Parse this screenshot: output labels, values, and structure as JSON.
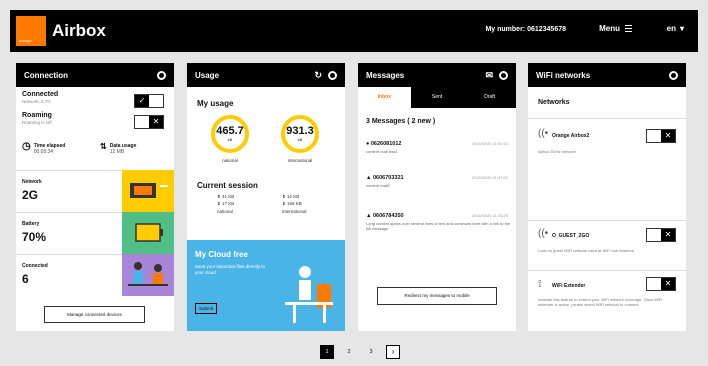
{
  "brand": {
    "logo_text": "orange",
    "title": "Airbox",
    "accent": "#ff7900"
  },
  "header": {
    "my_number": "My number: 0612345678",
    "menu_label": "Menu",
    "lang_label": "en"
  },
  "connection": {
    "title": "Connection",
    "connected_label": "Connected",
    "connected_sub": "Network: 3.7G",
    "roaming_label": "Roaming",
    "roaming_sub": "Roaming is Off",
    "time_label": "Time elapsed",
    "time_value": "00:05:34",
    "data_label": "Data usage",
    "data_value": "12 MB",
    "tiles": [
      {
        "label": "Network",
        "value": "2G"
      },
      {
        "label": "Battery",
        "value": "70%"
      },
      {
        "label": "Connected",
        "value": "6"
      }
    ],
    "manage_button": "Manage connected devices"
  },
  "usage": {
    "title": "Usage",
    "my_usage": "My usage",
    "national_value": "465.7",
    "national_unit": "kB",
    "national_label": "national",
    "intl_value": "931.3",
    "intl_unit": "kB",
    "intl_label": "international",
    "session_title": "Current session",
    "session_nat_up": "41 KB",
    "session_nat_down": "17 KB",
    "session_nat_label": "national",
    "session_int_up": "12 KB",
    "session_int_down": "156 KB",
    "session_int_label": "international",
    "cloud_title": "My Cloud free",
    "cloud_desc": "Save your important files directly to your cloud",
    "cloud_button": "Submit"
  },
  "messages": {
    "title": "Messages",
    "tabs": [
      "Inbox",
      "Sent",
      "Draft"
    ],
    "count": "3 Messages ( 2 new )",
    "items": [
      {
        "number": "0626081012",
        "time": "2015/02/20 11:50:10",
        "body": "content mail test2"
      },
      {
        "number": "0606703321",
        "time": "2015/02/20 11:47:02",
        "body": "content mail2"
      },
      {
        "number": "0606784350",
        "time": "2015/02/20 11:25:29",
        "body": "Long content spans over several lines of text and continues here with a link to the full message"
      }
    ],
    "redirect_button": "Redirect my messages to mobile"
  },
  "wifi": {
    "title": "WiFi networks",
    "networks_label": "Networks",
    "items": [
      {
        "name": "Orange Airbox2",
        "desc": "Airbox 5GHz network"
      },
      {
        "name": "O_GUEST_2GO",
        "desc": "Lock on guest WiFi network used at WiFi hub features"
      },
      {
        "name": "WiFi Extender",
        "desc": "Activate this feature to extend your WiFi network coverage. Once WiFi extender is active, please select WiFi network to connect."
      }
    ]
  },
  "pagination": {
    "pages": [
      "1",
      "2",
      "3"
    ],
    "next": "›"
  }
}
